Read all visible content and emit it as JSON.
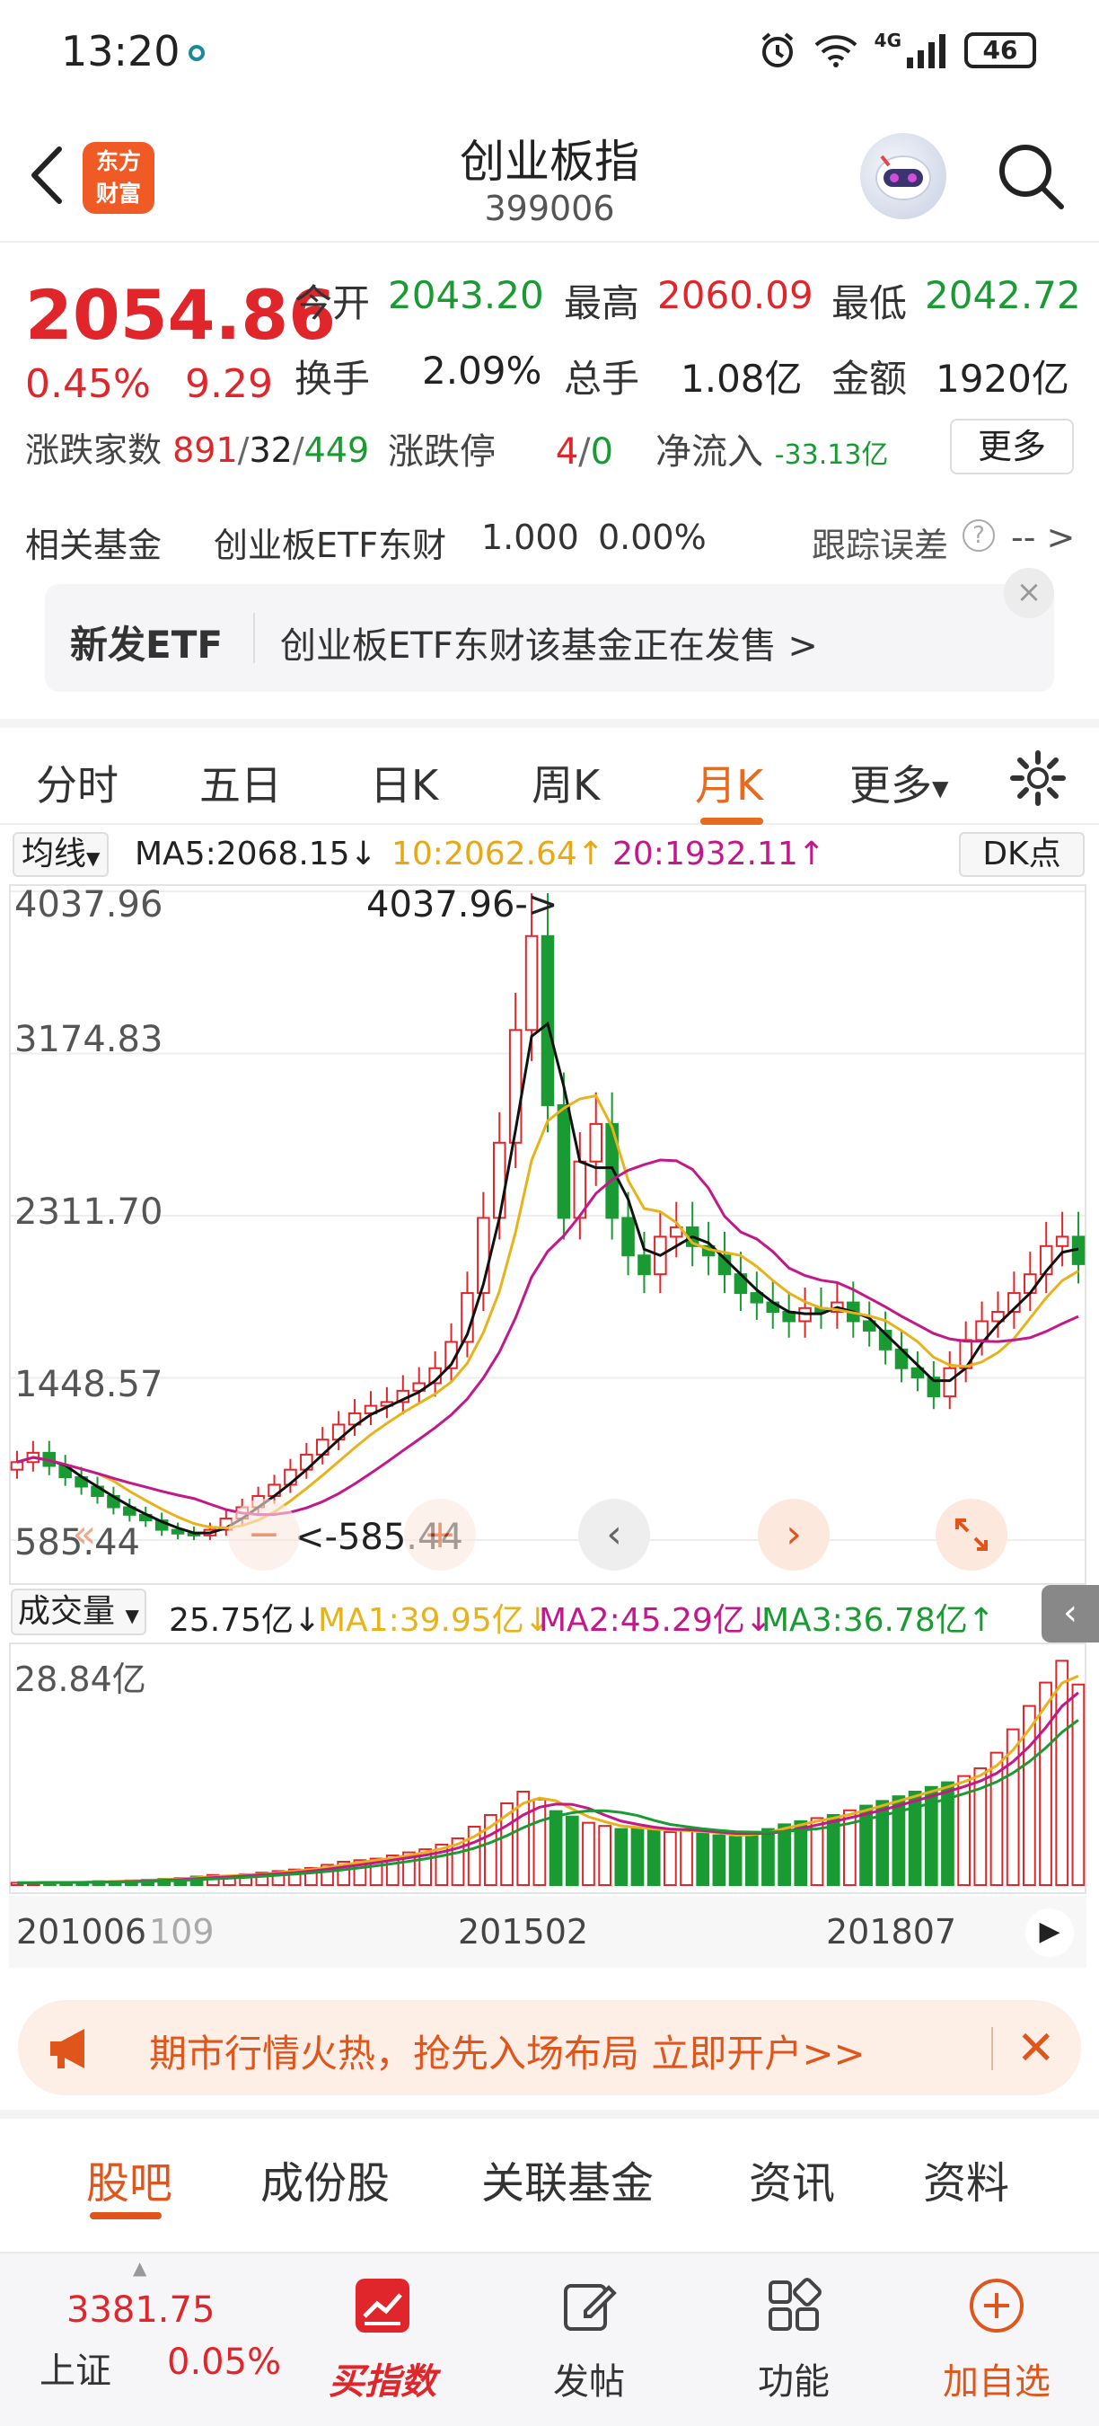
{
  "status_bar": {
    "time": "13:20",
    "network": "4G",
    "battery": "46"
  },
  "header": {
    "logo_text_line1": "东方",
    "logo_text_line2": "财富",
    "title": "创业板指",
    "code": "399006"
  },
  "quote": {
    "price": "2054.86",
    "change_pct": "0.45%",
    "change_value": "9.29",
    "open_label": "今开",
    "open": "2043.20",
    "high_label": "最高",
    "high": "2060.09",
    "low_label": "最低",
    "low": "2042.72",
    "turnover_rate_label": "换手",
    "turnover_rate": "2.09%",
    "volume_label": "总手",
    "volume": "1.08亿",
    "amount_label": "金额",
    "amount": "1920亿",
    "breadth_label": "涨跌家数",
    "breadth_up": "891",
    "breadth_flat": "32",
    "breadth_down": "449",
    "limit_label": "涨跌停",
    "limit_up": "4",
    "limit_down": "0",
    "net_inflow_label": "净流入",
    "net_inflow": "-33.13亿",
    "more_label": "更多"
  },
  "related_fund": {
    "label": "相关基金",
    "name": "创业板ETF东财",
    "nav": "1.000",
    "pct": "0.00%",
    "tracking_label": "跟踪误差",
    "tracking_value": "-- >"
  },
  "etf_banner": {
    "tag": "新发ETF",
    "text": "创业板ETF东财该基金正在发售  >",
    "close": "×"
  },
  "period_tabs": [
    "分时",
    "五日",
    "日K",
    "周K",
    "月K",
    "更多"
  ],
  "active_period": "月K",
  "ma_row": {
    "select": "均线",
    "ma5": "MA5:2068.15↓",
    "ma10": "10:2062.64↑",
    "ma20": "20:1932.11↑",
    "dk_button": "DK点"
  },
  "chart_data": {
    "type": "candlestick",
    "y_ticks": [
      "4037.96",
      "3174.83",
      "2311.70",
      "1448.57",
      "585.44"
    ],
    "ylim": [
      585.44,
      4037.96
    ],
    "max_marker": "4037.96->",
    "min_marker": "<-585.44",
    "x_labels": [
      "201006",
      "109",
      "201502",
      "201807"
    ],
    "series": [
      {
        "name": "MA5",
        "color": "#111111"
      },
      {
        "name": "MA10",
        "color": "#e8b21a"
      },
      {
        "name": "MA20",
        "color": "#c2188a"
      }
    ],
    "close_approx": [
      1000,
      1050,
      980,
      920,
      870,
      820,
      760,
      720,
      690,
      640,
      620,
      610,
      640,
      700,
      760,
      820,
      880,
      960,
      1040,
      1120,
      1200,
      1260,
      1300,
      1320,
      1380,
      1420,
      1500,
      1640,
      1900,
      2300,
      2700,
      3300,
      3800,
      2900,
      2300,
      2600,
      2800,
      2300,
      2100,
      2000,
      2200,
      2250,
      2150,
      2100,
      2000,
      1900,
      1850,
      1800,
      1750,
      1820,
      1800,
      1850,
      1750,
      1700,
      1600,
      1500,
      1450,
      1350,
      1500,
      1650,
      1750,
      1800,
      1900,
      2000,
      2150,
      2200,
      2054
    ],
    "volume_label": "成交量",
    "volume_current": "25.75亿↓",
    "vol_ma1": "MA1:39.95亿↓",
    "vol_ma2": "MA2:45.29亿↓",
    "vol_ma3": "MA3:36.78亿↑",
    "volume_max_label": "28.84亿",
    "volumes_approx": [
      0.3,
      0.3,
      0.4,
      0.3,
      0.4,
      0.5,
      0.5,
      0.6,
      0.7,
      0.8,
      0.9,
      1.1,
      1.3,
      1.2,
      1.4,
      1.6,
      1.8,
      2.0,
      2.2,
      2.6,
      3.0,
      3.2,
      3.4,
      3.8,
      4.2,
      4.6,
      5.2,
      6.0,
      7.5,
      9.0,
      10.5,
      12.0,
      11.0,
      9.5,
      8.8,
      8.0,
      7.6,
      7.2,
      7.4,
      7.0,
      6.8,
      7.2,
      6.6,
      6.4,
      6.2,
      6.8,
      7.2,
      7.8,
      8.2,
      8.6,
      9.0,
      9.6,
      10.2,
      10.8,
      11.4,
      12.0,
      12.6,
      13.2,
      14.0,
      15.0,
      17.0,
      20.0,
      23.0,
      26.0,
      28.8,
      25.75
    ]
  },
  "chart_controls": {
    "prev": "‹",
    "next": "›",
    "zoom_out": "−",
    "zoom_in": "+",
    "rewind": "«"
  },
  "promo": {
    "text": "期市行情火热，抢先入场布局 立即开户>>",
    "close": "✕"
  },
  "content_tabs": [
    "股吧",
    "成份股",
    "关联基金",
    "资讯",
    "资料"
  ],
  "active_content_tab": "股吧",
  "bottom_nav": {
    "index_price": "3381.75",
    "index_name": "上证",
    "index_pct": "0.05%",
    "buy_index": "买指数",
    "post": "发帖",
    "functions": "功能",
    "add_watch": "加自选"
  }
}
